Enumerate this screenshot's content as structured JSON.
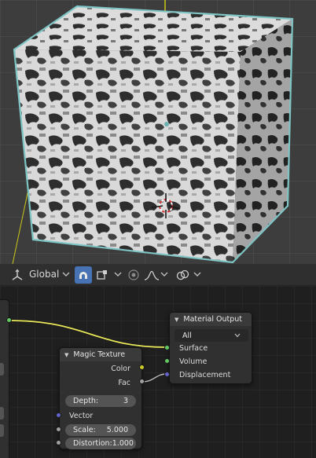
{
  "viewport": {
    "object": "cube",
    "texture": "magic-texture",
    "outline_color": "#7fc4c4",
    "cursor": "3d-cursor-icon"
  },
  "header": {
    "transform_orientation": "Global",
    "icons": [
      "transform-orientation-icon",
      "snap-icon",
      "snap-target-icon",
      "proportional-editing-icon",
      "falloff-icon",
      "overlay-icon"
    ]
  },
  "nodes": {
    "material_output": {
      "title": "Material Output",
      "target": "All",
      "inputs": [
        "Surface",
        "Volume",
        "Displacement"
      ]
    },
    "magic_texture": {
      "title": "Magic Texture",
      "outputs": [
        "Color",
        "Fac"
      ],
      "depth_label": "Depth:",
      "depth_value": "3",
      "vector_label": "Vector",
      "scale_label": "Scale:",
      "scale_value": "5.000",
      "distortion_label": "Distortion:",
      "distortion_value": "1.000"
    }
  },
  "colors": {
    "socket_shader": "#63c763",
    "socket_color": "#c7c729",
    "socket_float": "#a1a1a1",
    "socket_vector": "#6363c7",
    "wire_shader": "#e8e85a"
  }
}
